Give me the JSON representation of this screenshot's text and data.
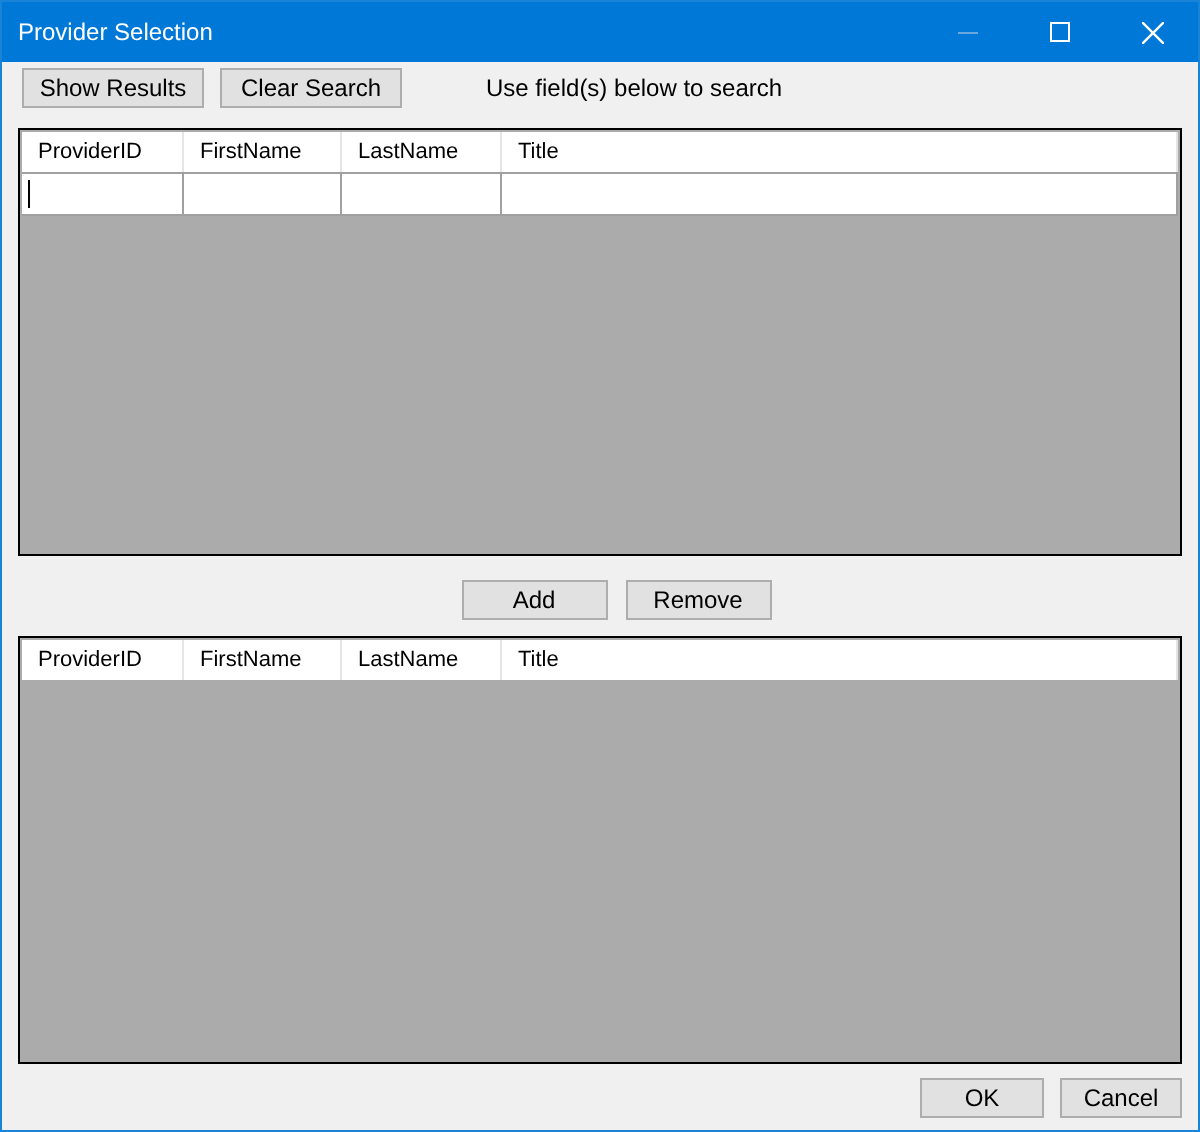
{
  "window": {
    "title": "Provider Selection"
  },
  "search_buttons": [
    "Show Results",
    "Clear Search"
  ],
  "search_hint": "Use field(s) below to search",
  "search_grid": {
    "columns": [
      "ProviderID",
      "FirstName",
      "LastName",
      "Title"
    ],
    "edit_row": true
  },
  "middle_buttons": [
    "Add",
    "Remove"
  ],
  "selected_grid": {
    "columns": [
      "ProviderID",
      "FirstName",
      "LastName",
      "Title"
    ],
    "edit_row": false
  },
  "dialog_buttons": [
    "OK",
    "Cancel"
  ]
}
